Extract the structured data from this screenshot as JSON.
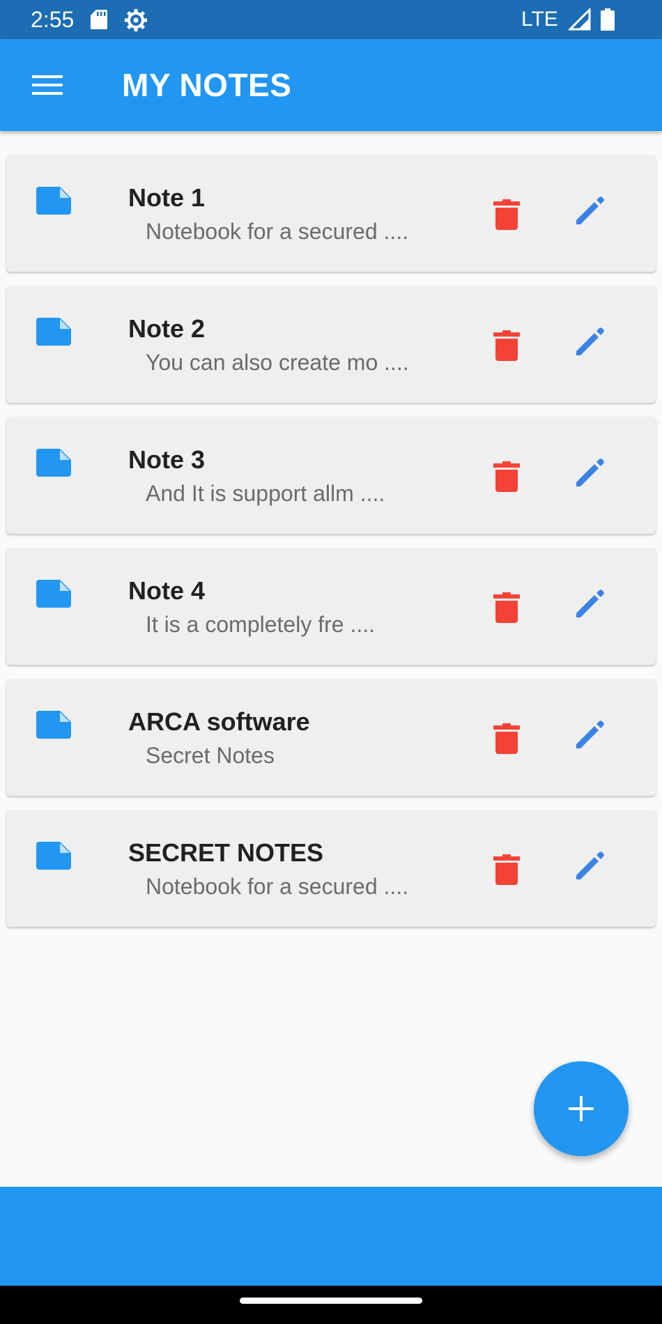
{
  "status_bar": {
    "time": "2:55",
    "network": "LTE",
    "icons": [
      "sd-card-icon",
      "settings-gear-icon",
      "signal-icon",
      "battery-icon"
    ]
  },
  "app_bar": {
    "title": "MY NOTES",
    "menu_icon": "hamburger-menu-icon"
  },
  "notes": [
    {
      "title": "Note 1",
      "preview": "Notebook for a secured ...."
    },
    {
      "title": "Note 2",
      "preview": "You can also create mo ...."
    },
    {
      "title": "Note 3",
      "preview": "And It is support allm ...."
    },
    {
      "title": "Note 4",
      "preview": "It is a completely fre ...."
    },
    {
      "title": "ARCA software",
      "preview": "Secret Notes"
    },
    {
      "title": "SECRET NOTES",
      "preview": "Notebook for a secured ...."
    }
  ],
  "note_actions": {
    "note_icon": "note-icon",
    "delete_icon": "trash-icon",
    "edit_icon": "pencil-icon"
  },
  "fab": {
    "icon": "plus-icon"
  },
  "colors": {
    "status_bar": "#1c6db3",
    "primary": "#2196f3",
    "delete": "#f44336",
    "edit": "#3b82e6",
    "card_bg": "#efefef",
    "title_text": "#212121",
    "preview_text": "#6b6b6b"
  }
}
